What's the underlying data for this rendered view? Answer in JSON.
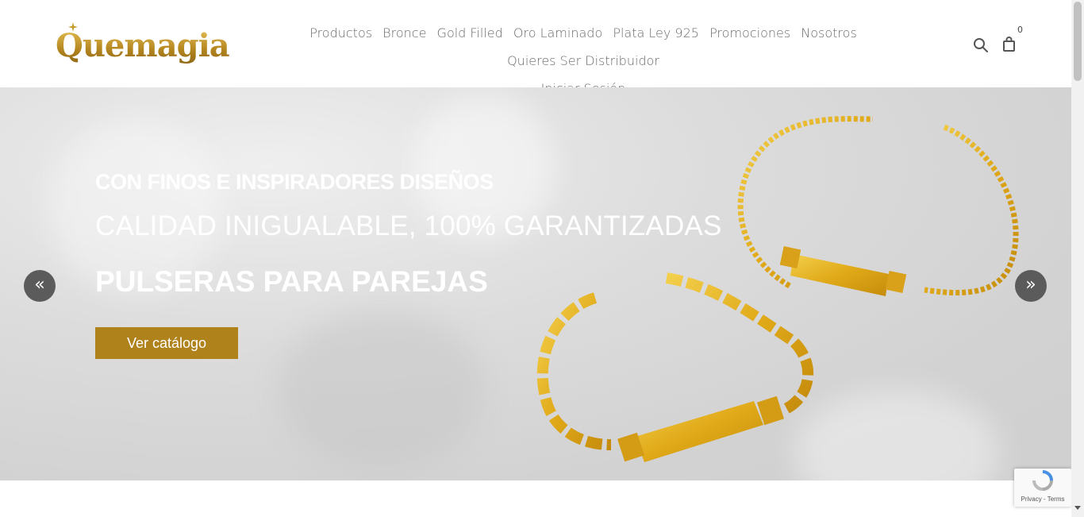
{
  "brand": {
    "name": "Quemagia",
    "color": "#c69a2b"
  },
  "nav": {
    "items": [
      {
        "label": "Productos"
      },
      {
        "label": "Bronce"
      },
      {
        "label": "Gold Filled"
      },
      {
        "label": "Oro Laminado"
      },
      {
        "label": "Plata Ley 925"
      },
      {
        "label": "Promociones"
      },
      {
        "label": "Nosotros"
      },
      {
        "label": "Quieres Ser Distribuidor"
      },
      {
        "label": "Iniciar Sesión"
      }
    ]
  },
  "header_icons": {
    "search": "search-icon",
    "cart": "shopping-bag-icon",
    "cart_count": "0"
  },
  "hero": {
    "subtitle": "CON FINOS E INSPIRADORES DISEÑOS",
    "line2": "CALIDAD INIGUALABLE, 100% GARANTIZADAS",
    "title": "PULSERAS PARA PAREJAS",
    "button_label": "Ver catálogo",
    "button_color": "#b0821c",
    "prev_glyph": "«",
    "next_glyph": "»"
  },
  "recaptcha": {
    "links": "Privacy - Terms"
  }
}
